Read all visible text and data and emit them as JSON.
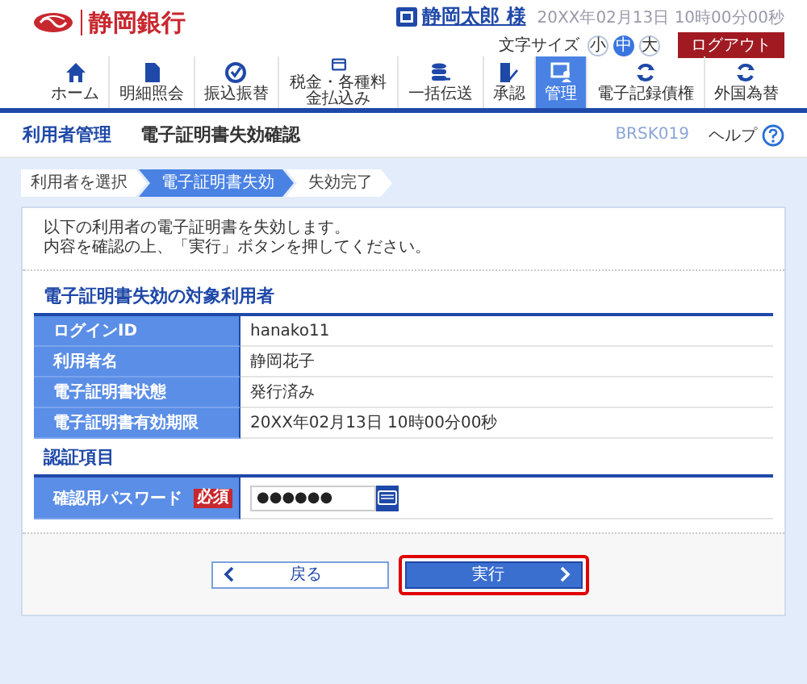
{
  "header": {
    "bank_name": "静岡銀行",
    "user_name": "静岡太郎 様",
    "datetime": "20XX年02月13日 10時00分00秒",
    "font_size_label": "文字サイズ",
    "logout": "ログアウト",
    "font_sizes": [
      {
        "label": "小",
        "selected": false
      },
      {
        "label": "中",
        "selected": true
      },
      {
        "label": "大",
        "selected": false
      }
    ]
  },
  "nav": [
    {
      "label": "ホーム",
      "selected": false
    },
    {
      "label": "明細照会",
      "selected": false
    },
    {
      "label": "振込振替",
      "selected": false
    },
    {
      "label": "税金・各種料金払込み",
      "selected": false
    },
    {
      "label": "一括伝送",
      "selected": false
    },
    {
      "label": "承認",
      "selected": false
    },
    {
      "label": "管理",
      "selected": true
    },
    {
      "label": "電子記録債権",
      "selected": false
    },
    {
      "label": "外国為替",
      "selected": false
    }
  ],
  "page": {
    "category": "利用者管理",
    "title": "電子証明書失効確認",
    "screen_id": "BRSK019",
    "help": "ヘルプ"
  },
  "steps": [
    {
      "label": "利用者を選択",
      "selected": false
    },
    {
      "label": "電子証明書失効",
      "selected": true
    },
    {
      "label": "失効完了",
      "selected": false
    }
  ],
  "message": [
    "以下の利用者の電子証明書を失効します。",
    "内容を確認の上、「実行」ボタンを押してください。"
  ],
  "target_section": {
    "title": "電子証明書失効の対象利用者",
    "rows": [
      {
        "label": "ログインID",
        "value": "hanako11"
      },
      {
        "label": "利用者名",
        "value": "静岡花子"
      },
      {
        "label": "電子証明書状態",
        "value": "発行済み"
      },
      {
        "label": "電子証明書有効期限",
        "value": "20XX年02月13日 10時00分00秒"
      }
    ]
  },
  "auth_section": {
    "title": "認証項目",
    "fields": [
      {
        "label": "確認用パスワード",
        "required_badge": "必須",
        "value": "●●●●●●"
      }
    ]
  },
  "buttons": [
    {
      "label": "戻る",
      "kind": "back",
      "highlighted": false
    },
    {
      "label": "実行",
      "kind": "primary",
      "highlighted": true
    }
  ]
}
